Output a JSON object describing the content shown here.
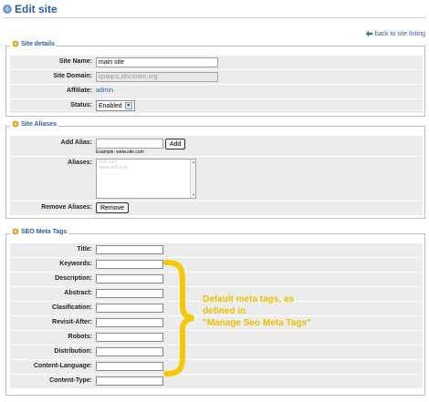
{
  "page": {
    "title": "Edit site"
  },
  "back_link": {
    "label": "back to site listing"
  },
  "site_details": {
    "legend": "Site details",
    "site_name": {
      "label": "Site Name:",
      "value": "main site"
    },
    "site_domain": {
      "label": "Site Domain:",
      "value": "qsaqcs.zincoram.org"
    },
    "affiliate": {
      "label": "Affiliate:",
      "value": "admin"
    },
    "status": {
      "label": "Status:",
      "value": "Enabled"
    }
  },
  "site_aliases": {
    "legend": "Site Aliases",
    "add_alias": {
      "label": "Add Alias:",
      "button": "Add",
      "example": "Example: www.site.com"
    },
    "aliases": {
      "label": "Aliases:",
      "items": [
        "zsr5.com",
        "www.zsr5.com"
      ]
    },
    "remove_aliases": {
      "label": "Remove Aliases:",
      "button": "Remove"
    }
  },
  "seo_meta_tags": {
    "legend": "SEO Meta Tags",
    "fields": [
      {
        "label": "Title:"
      },
      {
        "label": "Keywords:"
      },
      {
        "label": "Description:"
      },
      {
        "label": "Abstract:"
      },
      {
        "label": "Clasification:"
      },
      {
        "label": "Revisit-After:"
      },
      {
        "label": "Robots:"
      },
      {
        "label": "Distribution:"
      },
      {
        "label": "Content-Language:"
      },
      {
        "label": "Content-Type:"
      }
    ]
  },
  "annotation": {
    "lines": [
      "Default meta tags, as",
      "defined in",
      "\"Manage Seo Meta Tags\""
    ],
    "color": "#e8c200"
  },
  "colors": {
    "accent": "#2a5f9e",
    "row_bg": "#ececec",
    "border": "#bcbcbc"
  },
  "icons": {
    "title": "globe-icon",
    "back": "back-arrow-icon",
    "legend": "gear-icon"
  }
}
